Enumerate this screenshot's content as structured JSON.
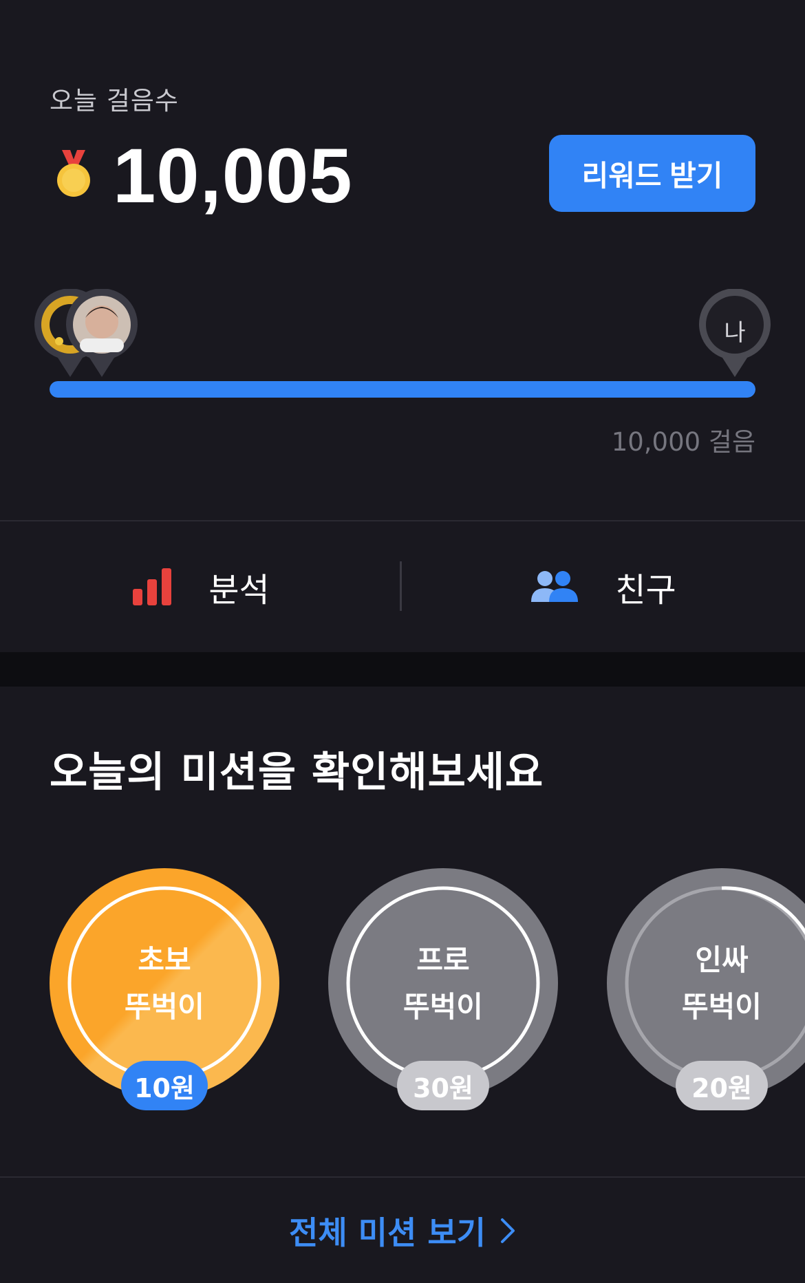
{
  "steps": {
    "label": "오늘 걸음수",
    "count": "10,005",
    "reward_button": "리워드 받기",
    "me_marker": "나",
    "goal_text": "10,000 걸음",
    "progress_fraction": 1.0
  },
  "quick_nav": {
    "analysis_label": "분석",
    "friends_label": "친구"
  },
  "missions": {
    "title": "오늘의 미션을 확인해보세요",
    "items": [
      {
        "name_line1": "초보",
        "name_line2": "뚜벅이",
        "reward": "10원",
        "status": "active"
      },
      {
        "name_line1": "프로",
        "name_line2": "뚜벅이",
        "reward": "30원",
        "status": "locked"
      },
      {
        "name_line1": "인싸",
        "name_line2": "뚜벅이",
        "reward": "20원",
        "status": "locked"
      }
    ],
    "view_all": "전체 미션 보기"
  },
  "colors": {
    "background": "#19181f",
    "accent_blue": "#3183f5",
    "mission_orange": "#f9a52b",
    "mission_gray": "#7b7b82"
  },
  "icons": {
    "medal": "gold-medal-icon",
    "analysis": "bar-chart-icon",
    "friends": "people-icon",
    "chevron": "chevron-right-icon"
  }
}
